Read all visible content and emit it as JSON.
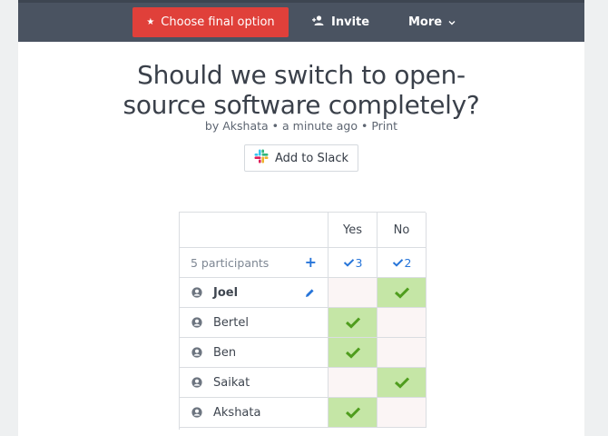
{
  "toolbar": {
    "final_option_label": "Choose final option",
    "invite_label": "Invite",
    "more_label": "More"
  },
  "poll": {
    "title_line1": "Should we switch to open-",
    "title_line2": "source software completely?",
    "author_prefix": "by",
    "author": "Akshata",
    "separator": "•",
    "time_ago": "a minute ago",
    "print_label": "Print",
    "slack_label": "Add to Slack",
    "participants_label": "5 participants",
    "add_symbol": "+",
    "options": [
      {
        "label": "Yes",
        "count": "3"
      },
      {
        "label": "No",
        "count": "2"
      }
    ],
    "participants": [
      {
        "name": "Joel",
        "vote": "No",
        "current_user": true
      },
      {
        "name": "Bertel",
        "vote": "Yes",
        "current_user": false
      },
      {
        "name": "Ben",
        "vote": "Yes",
        "current_user": false
      },
      {
        "name": "Saikat",
        "vote": "No",
        "current_user": false
      },
      {
        "name": "Akshata",
        "vote": "Yes",
        "current_user": false
      }
    ]
  },
  "colors": {
    "topbar": "#4a5361",
    "accent": "#e0403a",
    "vote_yes_bg": "#c5e6a6",
    "check_green": "#4f9d1e",
    "link_blue": "#2775d9"
  }
}
